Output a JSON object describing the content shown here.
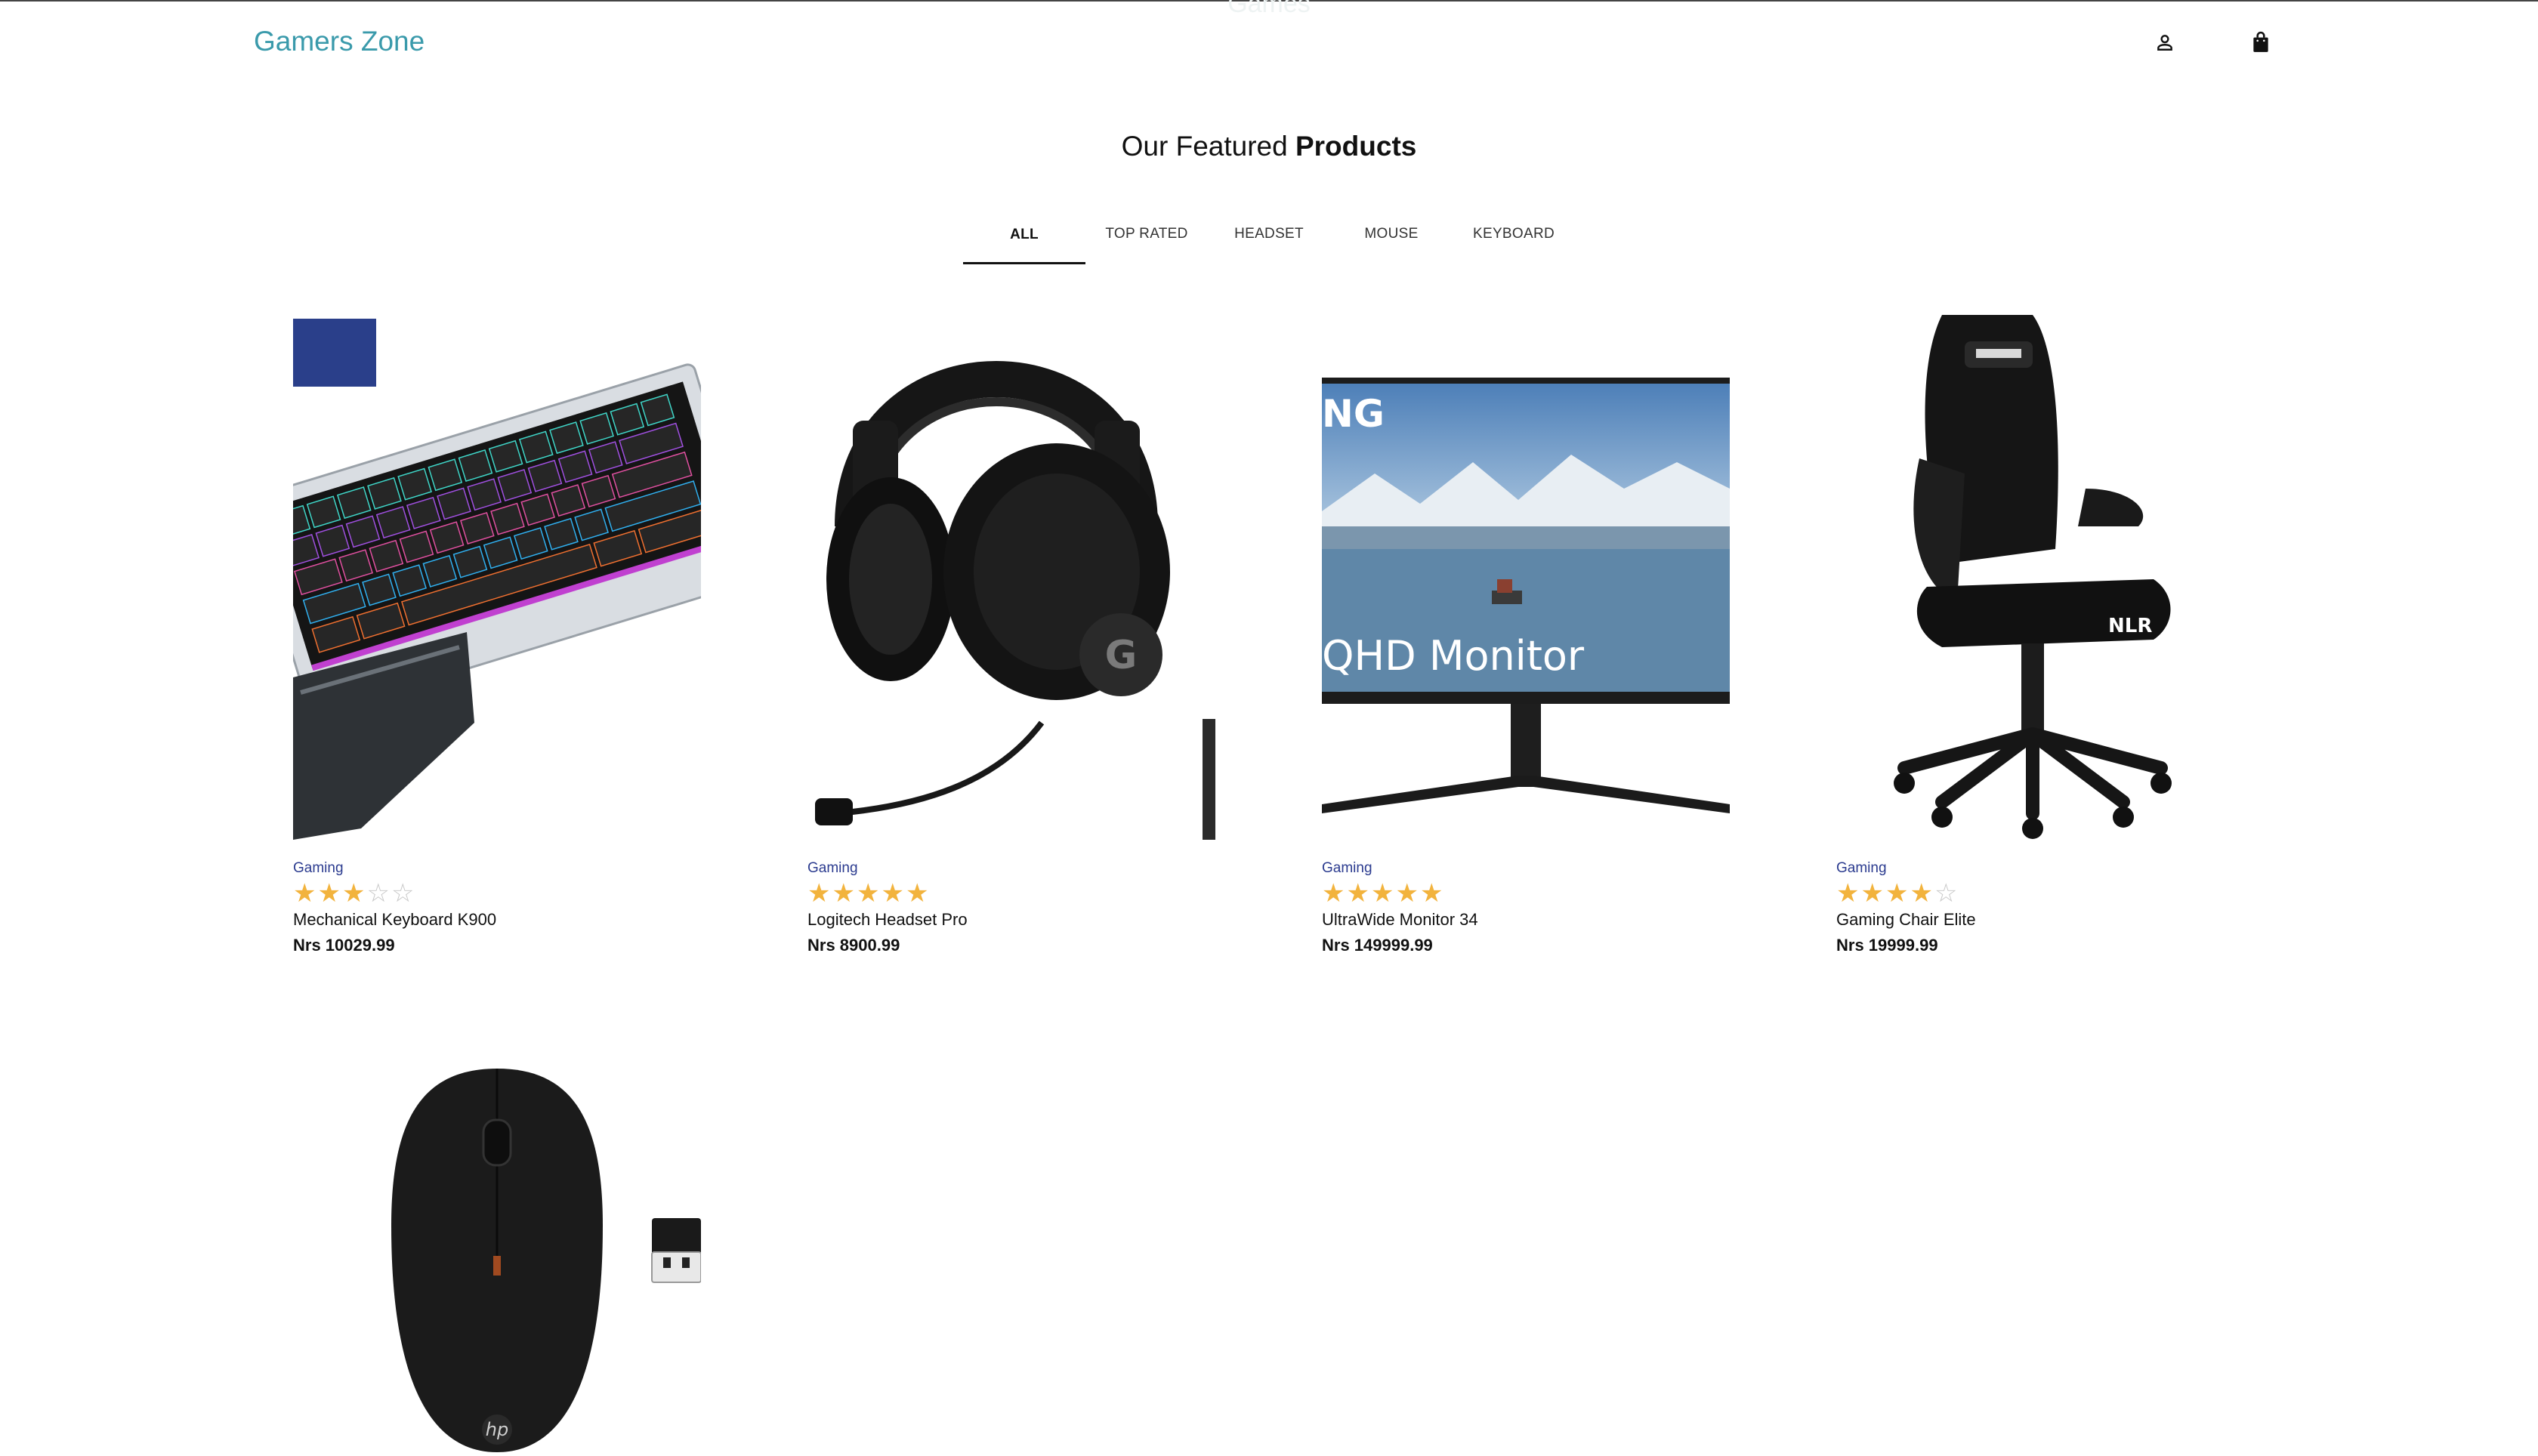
{
  "header": {
    "ghost_title": "Games",
    "logo": "Gamers Zone",
    "icons": [
      "user-icon",
      "shopping-bag-icon"
    ]
  },
  "section": {
    "title_prefix": "Our Featured ",
    "title_bold": "Products"
  },
  "tabs": [
    {
      "label": "ALL",
      "active": true
    },
    {
      "label": "TOP RATED",
      "active": false
    },
    {
      "label": "HEADSET",
      "active": false
    },
    {
      "label": "MOUSE",
      "active": false
    },
    {
      "label": "KEYBOARD",
      "active": false
    }
  ],
  "products": [
    {
      "category": "Gaming",
      "rating": 3,
      "max_rating": 5,
      "name": "Mechanical Keyboard K900",
      "price": "Nrs 10029.99",
      "image": "rgb-mechanical-keyboard"
    },
    {
      "category": "Gaming",
      "rating": 5,
      "max_rating": 5,
      "name": "Logitech Headset Pro",
      "price": "Nrs 8900.99",
      "image": "gaming-headset"
    },
    {
      "category": "Gaming",
      "rating": 5,
      "max_rating": 5,
      "name": "UltraWide Monitor 34",
      "price": "Nrs 149999.99",
      "image": "monitor",
      "image_text": [
        "NG",
        "QHD Monitor"
      ]
    },
    {
      "category": "Gaming",
      "rating": 4,
      "max_rating": 5,
      "name": "Gaming Chair Elite",
      "price": "Nrs 19999.99",
      "image": "gaming-chair",
      "image_text": [
        "NLR"
      ]
    },
    {
      "category": "",
      "rating": 0,
      "max_rating": 0,
      "name": "",
      "price": "",
      "image": "wireless-mouse",
      "image_text": [
        "hp"
      ]
    }
  ],
  "colors": {
    "accent": "#3a9aab",
    "category": "#2b3b8f",
    "star_on": "#f2b33d",
    "star_off": "#c8c8c8"
  }
}
